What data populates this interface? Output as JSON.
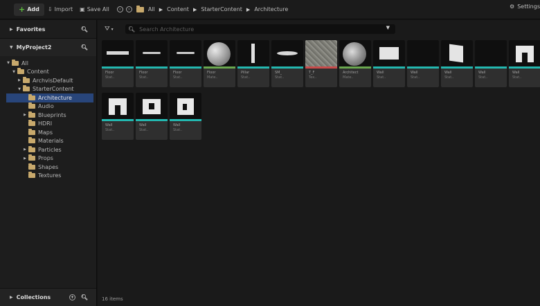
{
  "toolbar": {
    "add_label": "Add",
    "import_label": "Import",
    "save_all_label": "Save All",
    "breadcrumb": [
      "All",
      "Content",
      "StarterContent",
      "Architecture"
    ],
    "settings_label": "Settings"
  },
  "sources": {
    "favorites_label": "Favorites",
    "project_label": "MyProject2",
    "collections_label": "Collections",
    "tree": [
      {
        "label": "All",
        "depth": 0,
        "arrow": "▼",
        "selected": false
      },
      {
        "label": "Content",
        "depth": 1,
        "arrow": "▼",
        "selected": false
      },
      {
        "label": "ArchvisDefault",
        "depth": 2,
        "arrow": "▶",
        "selected": false
      },
      {
        "label": "StarterContent",
        "depth": 2,
        "arrow": "▼",
        "selected": false
      },
      {
        "label": "Architecture",
        "depth": 3,
        "arrow": "",
        "selected": true
      },
      {
        "label": "Audio",
        "depth": 3,
        "arrow": "",
        "selected": false
      },
      {
        "label": "Blueprints",
        "depth": 3,
        "arrow": "▶",
        "selected": false
      },
      {
        "label": "HDRI",
        "depth": 3,
        "arrow": "",
        "selected": false
      },
      {
        "label": "Maps",
        "depth": 3,
        "arrow": "",
        "selected": false
      },
      {
        "label": "Materials",
        "depth": 3,
        "arrow": "",
        "selected": false
      },
      {
        "label": "Particles",
        "depth": 3,
        "arrow": "▶",
        "selected": false
      },
      {
        "label": "Props",
        "depth": 3,
        "arrow": "▶",
        "selected": false
      },
      {
        "label": "Shapes",
        "depth": 3,
        "arrow": "",
        "selected": false
      },
      {
        "label": "Textures",
        "depth": 3,
        "arrow": "",
        "selected": false
      }
    ]
  },
  "content": {
    "search_placeholder": "Search Architecture",
    "status": "16 items",
    "assets": [
      {
        "name": "Floor",
        "type": "Stat..",
        "shape": "floor",
        "bar": "mesh"
      },
      {
        "name": "Floor",
        "type": "Stat..",
        "shape": "floor-thin",
        "bar": "mesh"
      },
      {
        "name": "Floor",
        "type": "Stat..",
        "shape": "floor-thin",
        "bar": "mesh"
      },
      {
        "name": "Floor",
        "type": "Mate..",
        "shape": "sphere",
        "bar": "mat"
      },
      {
        "name": "Pillar",
        "type": "Stat..",
        "shape": "pillar",
        "bar": "mesh"
      },
      {
        "name": "SM_",
        "type": "Stat..",
        "shape": "disc",
        "bar": "mesh"
      },
      {
        "name": "T_F",
        "type": "Tex..",
        "shape": "noise",
        "bar": "tex"
      },
      {
        "name": "Architect",
        "type": "Mate..",
        "shape": "moon",
        "bar": "mat"
      },
      {
        "name": "Wall",
        "type": "Stat..",
        "shape": "wall",
        "bar": "mesh"
      },
      {
        "name": "Wall",
        "type": "Stat..",
        "shape": "none",
        "bar": "mesh"
      },
      {
        "name": "Wall",
        "type": "Stat..",
        "shape": "wall-angle",
        "bar": "mesh"
      },
      {
        "name": "Wall",
        "type": "Stat..",
        "shape": "none",
        "bar": "mesh"
      },
      {
        "name": "Wall",
        "type": "Stat..",
        "shape": "door",
        "bar": "mesh"
      },
      {
        "name": "Wall",
        "type": "Stat..",
        "shape": "door",
        "bar": "mesh"
      },
      {
        "name": "Wall",
        "type": "Stat..",
        "shape": "window",
        "bar": "mesh"
      },
      {
        "name": "Wall",
        "type": "Stat..",
        "shape": "window2",
        "bar": "mesh"
      }
    ]
  }
}
